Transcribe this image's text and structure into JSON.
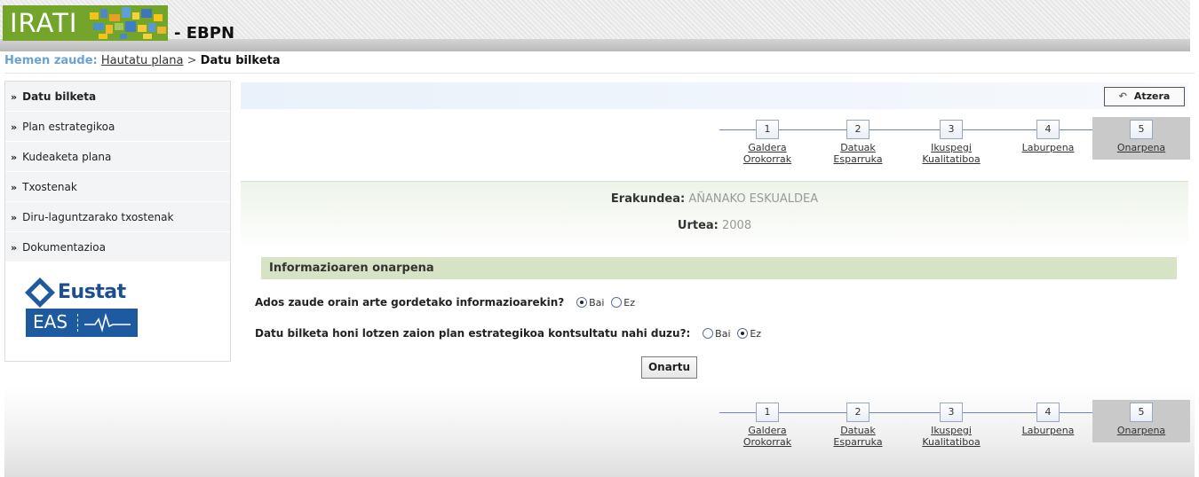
{
  "header": {
    "logo_text": "IRATI",
    "app_suffix": "- EBPN"
  },
  "breadcrumb": {
    "label": "Hemen zaude:",
    "link": "Hautatu plana",
    "separator": ">",
    "current": "Datu bilketa"
  },
  "sidebar": {
    "items": [
      {
        "label": "Datu bilketa"
      },
      {
        "label": "Plan estrategikoa"
      },
      {
        "label": "Kudeaketa plana"
      },
      {
        "label": "Txostenak"
      },
      {
        "label": "Diru-laguntzarako txostenak"
      },
      {
        "label": "Dokumentazioa"
      }
    ],
    "logo_top": "Eustat",
    "logo_bottom": "EAS"
  },
  "toolbar": {
    "back_label": "Atzera"
  },
  "wizard": {
    "steps": [
      {
        "num": "1",
        "line1": "Galdera",
        "line2": "Orokorrak"
      },
      {
        "num": "2",
        "line1": "Datuak",
        "line2": "Esparruka"
      },
      {
        "num": "3",
        "line1": "Ikuspegi",
        "line2": "Kualitatiboa"
      },
      {
        "num": "4",
        "line1": "Laburpena",
        "line2": ""
      },
      {
        "num": "5",
        "line1": "Onarpena",
        "line2": ""
      }
    ],
    "active": "5"
  },
  "info": {
    "org_label": "Erakundea:",
    "org_value": "AÑANAKO ESKUALDEA",
    "year_label": "Urtea:",
    "year_value": "2008"
  },
  "section": {
    "title": "Informazioaren onarpena"
  },
  "questions": [
    {
      "text": "Ados zaude orain arte gordetako informazioarekin?",
      "yes": "Bai",
      "no": "Ez",
      "selected": "yes"
    },
    {
      "text": "Datu bilketa honi lotzen zaion plan estrategikoa kontsultatu nahi duzu?:",
      "yes": "Bai",
      "no": "Ez",
      "selected": "no"
    }
  ],
  "actions": {
    "accept_label": "Onartu"
  },
  "colors": {
    "logo_green": "#73a52b",
    "breadcrumb_label": "#6aa3d2",
    "section_head": "#d6e3c5",
    "eustat_blue": "#1d5a9f"
  }
}
